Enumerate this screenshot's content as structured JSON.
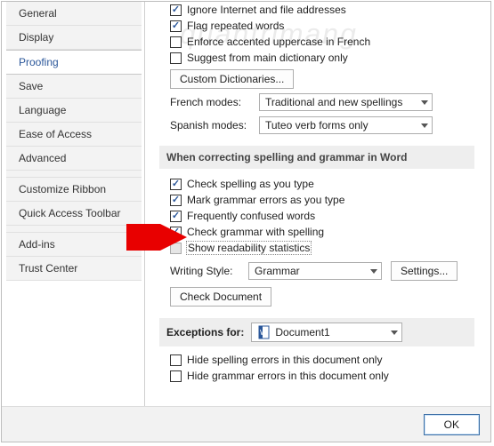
{
  "sidebar": {
    "items": [
      {
        "label": "General"
      },
      {
        "label": "Display"
      },
      {
        "label": "Proofing"
      },
      {
        "label": "Save"
      },
      {
        "label": "Language"
      },
      {
        "label": "Ease of Access"
      },
      {
        "label": "Advanced"
      },
      {
        "label": "Customize Ribbon"
      },
      {
        "label": "Quick Access Toolbar"
      },
      {
        "label": "Add-ins"
      },
      {
        "label": "Trust Center"
      }
    ],
    "selected_index": 2
  },
  "autocorrect": {
    "ignore_internet": "Ignore Internet and file addresses",
    "flag_repeated": "Flag repeated words",
    "enforce_french": "Enforce accented uppercase in French",
    "suggest_main": "Suggest from main dictionary only",
    "custom_dict_btn": "Custom Dictionaries...",
    "french_label": "French modes:",
    "french_value": "Traditional and new spellings",
    "spanish_label": "Spanish modes:",
    "spanish_value": "Tuteo verb forms only"
  },
  "correcting": {
    "heading": "When correcting spelling and grammar in Word",
    "check_spelling": "Check spelling as you type",
    "mark_grammar": "Mark grammar errors as you type",
    "freq_confused": "Frequently confused words",
    "check_grammar": "Check grammar with spelling",
    "readability": "Show readability statistics",
    "writing_style_label": "Writing Style:",
    "writing_style_value": "Grammar",
    "settings_btn": "Settings...",
    "check_doc_btn": "Check Document"
  },
  "exceptions": {
    "label": "Exceptions for:",
    "doc": "Document1",
    "hide_spelling": "Hide spelling errors in this document only",
    "hide_grammar": "Hide grammar errors in this document only"
  },
  "footer": {
    "ok": "OK"
  },
  "watermark": "quantrimang"
}
